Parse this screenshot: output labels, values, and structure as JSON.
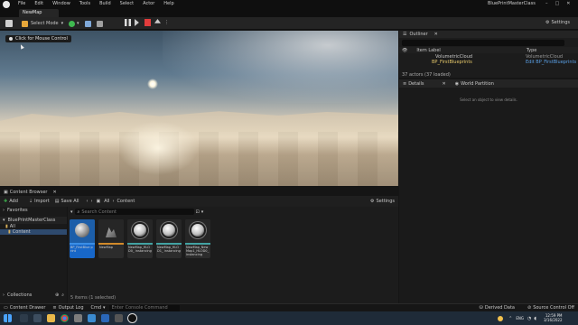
{
  "menubar": {
    "items": [
      "File",
      "Edit",
      "Window",
      "Tools",
      "Build",
      "Select",
      "Actor",
      "Help"
    ],
    "project_title": "BluePrintMasterClass"
  },
  "level_tab": {
    "label": "NewMap"
  },
  "toolbar": {
    "select_mode": "Select Mode",
    "settings": "Settings"
  },
  "viewport": {
    "click_hint": "Click for Mouse Control"
  },
  "outliner": {
    "title": "Outliner",
    "col_item": "Item Label",
    "col_type": "Type",
    "items": [
      {
        "label": "VolumetricCloud",
        "type": "VolumetricCloud"
      },
      {
        "label": "BP_FirstBlueprints",
        "type": "Edit BP_FirstBlueprints"
      }
    ],
    "actor_count": "37 actors (37 loaded)"
  },
  "details": {
    "tab_details": "Details",
    "tab_world": "World Partition",
    "empty_text": "Select an object to view details."
  },
  "content_browser": {
    "tab": "Content Browser",
    "add": "Add",
    "import": "Import",
    "save_all": "Save All",
    "path": [
      "All",
      "Content"
    ],
    "settings": "Settings",
    "search_placeholder": "Search Content",
    "favorites": "Favorites",
    "project_root": "BluePrintMasterClass",
    "tree": [
      "All",
      "Content"
    ],
    "collections": "Collections",
    "status": "5 items (1 selected)",
    "assets": [
      {
        "name": "BP_FirstBlue print",
        "sub": "",
        "selected": true
      },
      {
        "name": "NewMap",
        "sub": "",
        "selected": false
      },
      {
        "name": "NewMap_HLOD0_ instancing",
        "sub": "",
        "selected": false
      },
      {
        "name": "NewMap_HLOD1_ instancing",
        "sub": "",
        "selected": false
      },
      {
        "name": "NewMap_New Map1_HLOD0_ instancing",
        "sub": "",
        "selected": false
      }
    ]
  },
  "statusbar": {
    "content_drawer": "Content Drawer",
    "output_log": "Output Log",
    "cmd": "Cmd",
    "console_placeholder": "Enter Console Command",
    "derived_data": "Derived Data",
    "source_control": "Source Control Off"
  },
  "taskbar": {
    "lang": "ENG",
    "time": "12:59 PM",
    "date": "3/16/2022"
  }
}
